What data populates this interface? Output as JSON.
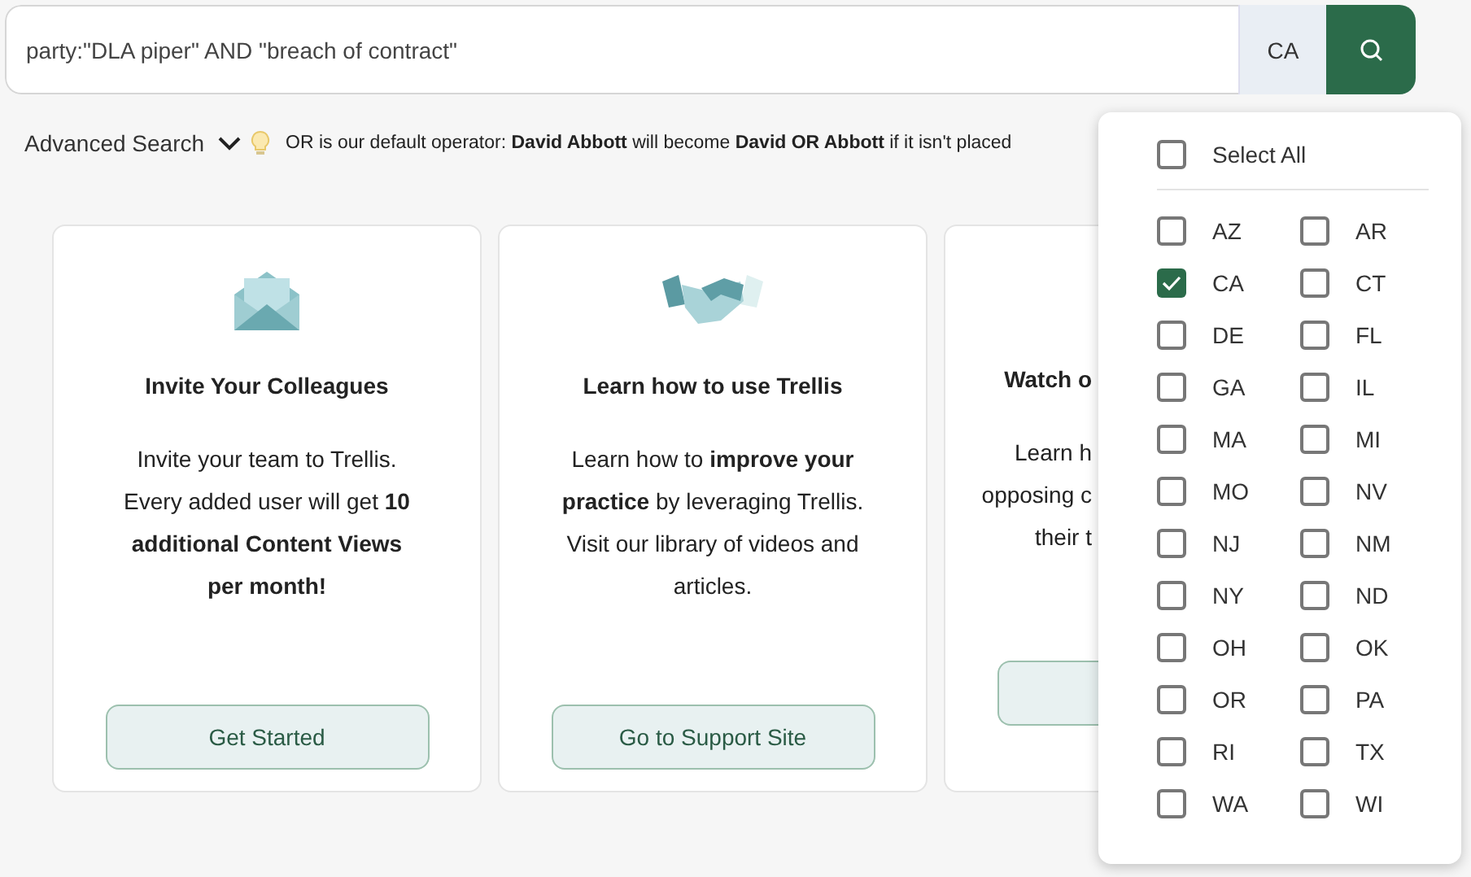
{
  "search": {
    "value": "party:\"DLA piper\" AND \"breach of contract\"",
    "jurisdiction": "CA"
  },
  "advanced_search": {
    "label": "Advanced Search",
    "expanded": false
  },
  "hint": "OR is our default operator: **David Abbott** will become **David OR Abbott** if it isn't placed",
  "cards": [
    {
      "kind": "full",
      "title": "Invite Your Colleagues",
      "description": "Invite your team to Trellis. Every added user will get **10 additional Content Views per month!**",
      "button": "Get Started"
    },
    {
      "kind": "full",
      "title": "Learn how to use Trellis",
      "description": "Learn how to **improve your practice** by leveraging Trellis. Visit our library of videos and articles.",
      "button": "Go to Support Site"
    },
    {
      "kind": "clipped",
      "title": "Watch o",
      "lines": [
        "Learn h",
        "opposing c",
        "their t"
      ]
    }
  ],
  "state_menu": {
    "select_all": {
      "label": "Select All",
      "checked": false
    },
    "states": [
      {
        "label": "AZ",
        "checked": false
      },
      {
        "label": "AR",
        "checked": false
      },
      {
        "label": "CA",
        "checked": true
      },
      {
        "label": "CT",
        "checked": false
      },
      {
        "label": "DE",
        "checked": false
      },
      {
        "label": "FL",
        "checked": false
      },
      {
        "label": "GA",
        "checked": false
      },
      {
        "label": "IL",
        "checked": false
      },
      {
        "label": "MA",
        "checked": false
      },
      {
        "label": "MI",
        "checked": false
      },
      {
        "label": "MO",
        "checked": false
      },
      {
        "label": "NV",
        "checked": false
      },
      {
        "label": "NJ",
        "checked": false
      },
      {
        "label": "NM",
        "checked": false
      },
      {
        "label": "NY",
        "checked": false
      },
      {
        "label": "ND",
        "checked": false
      },
      {
        "label": "OH",
        "checked": false
      },
      {
        "label": "OK",
        "checked": false
      },
      {
        "label": "OR",
        "checked": false
      },
      {
        "label": "PA",
        "checked": false
      },
      {
        "label": "RI",
        "checked": false
      },
      {
        "label": "TX",
        "checked": false
      },
      {
        "label": "WA",
        "checked": false
      },
      {
        "label": "WI",
        "checked": false
      }
    ]
  }
}
